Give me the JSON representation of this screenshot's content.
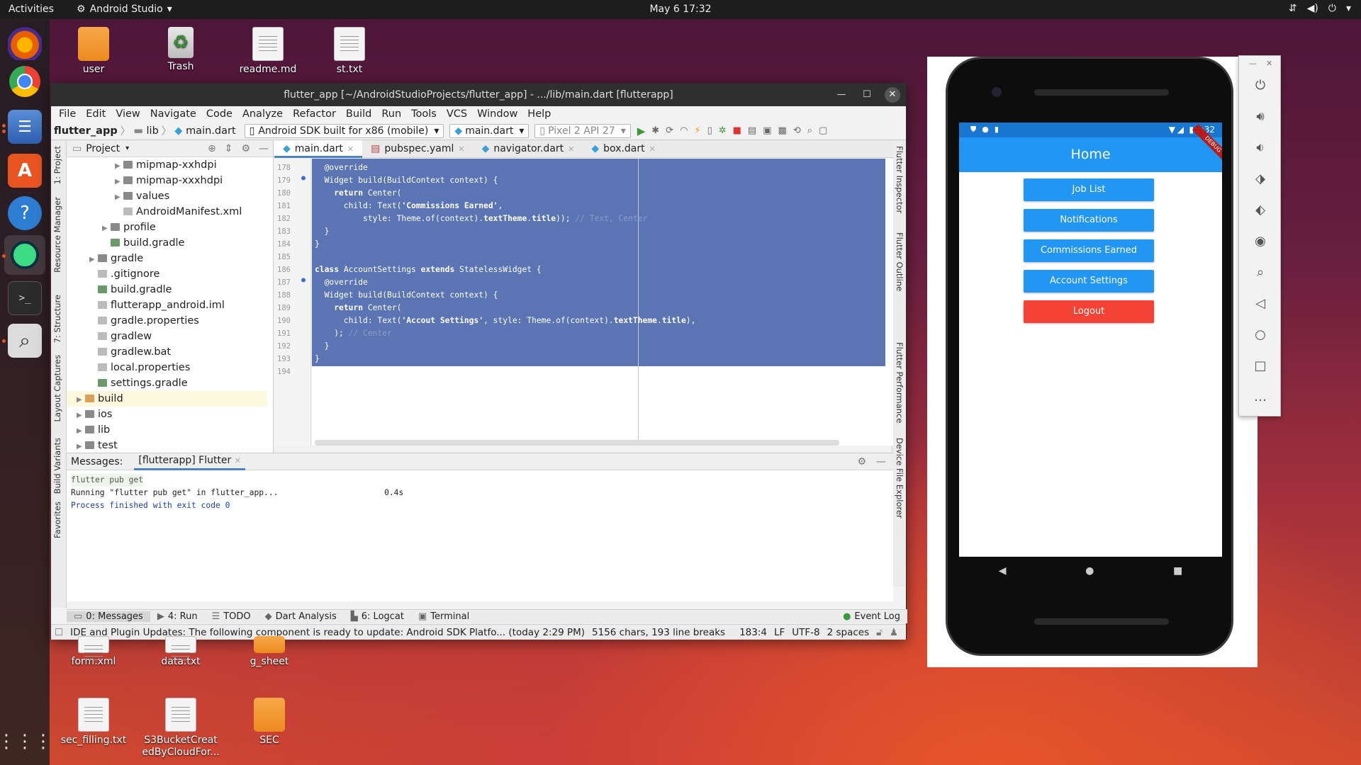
{
  "topbar": {
    "activities": "Activities",
    "app": "Android Studio",
    "clock": "May 6  17:32"
  },
  "desktop": {
    "top_icons": [
      {
        "label": "user",
        "kind": "folder"
      },
      {
        "label": "Trash",
        "kind": "trash"
      },
      {
        "label": "readme.md",
        "kind": "doc"
      },
      {
        "label": "st.txt",
        "kind": "doc"
      }
    ],
    "bottom_row1": [
      {
        "label": "form.xml",
        "kind": "doc"
      },
      {
        "label": "data.txt",
        "kind": "doc"
      },
      {
        "label": "g_sheet",
        "kind": "folder"
      }
    ],
    "bottom_row2": [
      {
        "label": "sec_filling.txt",
        "kind": "doc"
      },
      {
        "label": "S3BucketCreatedByCloudFor...",
        "kind": "doc"
      },
      {
        "label": "SEC",
        "kind": "folder"
      }
    ]
  },
  "ide": {
    "title": "flutter_app [~/AndroidStudioProjects/flutter_app] - .../lib/main.dart [flutterapp]",
    "menu": [
      "File",
      "Edit",
      "View",
      "Navigate",
      "Code",
      "Analyze",
      "Refactor",
      "Build",
      "Run",
      "Tools",
      "VCS",
      "Window",
      "Help"
    ],
    "breadcrumb": [
      "flutter_app",
      "lib",
      "main.dart"
    ],
    "device_combo": "Android SDK built for x86 (mobile)",
    "config_combo": "main.dart",
    "avd_combo": "Pixel 2 API 27",
    "project_label": "Project",
    "tree": [
      {
        "indent": 4,
        "arrow": "▶",
        "icon": "fold",
        "label": "mipmap-xxhdpi"
      },
      {
        "indent": 4,
        "arrow": "▶",
        "icon": "fold",
        "label": "mipmap-xxxhdpi"
      },
      {
        "indent": 4,
        "arrow": "▶",
        "icon": "fold",
        "label": "values"
      },
      {
        "indent": 4,
        "arrow": "",
        "icon": "file",
        "label": "AndroidManifest.xml"
      },
      {
        "indent": 3,
        "arrow": "▶",
        "icon": "fold",
        "label": "profile"
      },
      {
        "indent": 3,
        "arrow": "",
        "icon": "gradle",
        "label": "build.gradle"
      },
      {
        "indent": 2,
        "arrow": "▶",
        "icon": "fold",
        "label": "gradle"
      },
      {
        "indent": 2,
        "arrow": "",
        "icon": "file",
        "label": ".gitignore"
      },
      {
        "indent": 2,
        "arrow": "",
        "icon": "gradle",
        "label": "build.gradle"
      },
      {
        "indent": 2,
        "arrow": "",
        "icon": "file",
        "label": "flutterapp_android.iml"
      },
      {
        "indent": 2,
        "arrow": "",
        "icon": "file",
        "label": "gradle.properties"
      },
      {
        "indent": 2,
        "arrow": "",
        "icon": "file",
        "label": "gradlew"
      },
      {
        "indent": 2,
        "arrow": "",
        "icon": "file",
        "label": "gradlew.bat"
      },
      {
        "indent": 2,
        "arrow": "",
        "icon": "file",
        "label": "local.properties"
      },
      {
        "indent": 2,
        "arrow": "",
        "icon": "gradle",
        "label": "settings.gradle"
      },
      {
        "indent": 1,
        "arrow": "▶",
        "icon": "foldy",
        "label": "build",
        "hl": true
      },
      {
        "indent": 1,
        "arrow": "▶",
        "icon": "fold",
        "label": "ios"
      },
      {
        "indent": 1,
        "arrow": "▶",
        "icon": "fold",
        "label": "lib"
      },
      {
        "indent": 1,
        "arrow": "▶",
        "icon": "fold",
        "label": "test"
      }
    ],
    "tabs": [
      "main.dart",
      "pubspec.yaml",
      "navigator.dart",
      "box.dart"
    ],
    "line_numbers": [
      "178",
      "179",
      "180",
      "181",
      "182",
      "183",
      "184",
      "185",
      "186",
      "187",
      "188",
      "189",
      "190",
      "191",
      "192",
      "193",
      "194"
    ],
    "code_lines": [
      [
        {
          "t": "  @override"
        }
      ],
      [
        {
          "t": "  Widget build(BuildContext context) {"
        }
      ],
      [
        {
          "t": "    "
        },
        {
          "t": "return",
          "b": 1
        },
        {
          "t": " Center("
        }
      ],
      [
        {
          "t": "      child: Text("
        },
        {
          "t": "'Commissions Earned'",
          "b": 1
        },
        {
          "t": ","
        }
      ],
      [
        {
          "t": "          style: Theme."
        },
        {
          "t": "of"
        },
        {
          "t": "(context)."
        },
        {
          "t": "textTheme",
          "b": 1
        },
        {
          "t": "."
        },
        {
          "t": "title",
          "b": 1
        },
        {
          "t": ")); "
        },
        {
          "t": "// Text, Center",
          "c": 1
        }
      ],
      [
        {
          "t": "  }"
        }
      ],
      [
        {
          "t": "}"
        }
      ],
      [
        {
          "t": ""
        }
      ],
      [
        {
          "t": "class",
          "b": 1
        },
        {
          "t": " AccountSettings "
        },
        {
          "t": "extends",
          "b": 1
        },
        {
          "t": " StatelessWidget {"
        }
      ],
      [
        {
          "t": "  @override"
        }
      ],
      [
        {
          "t": "  Widget build(BuildContext context) {"
        }
      ],
      [
        {
          "t": "    "
        },
        {
          "t": "return",
          "b": 1
        },
        {
          "t": " Center("
        }
      ],
      [
        {
          "t": "      child: Text("
        },
        {
          "t": "'Accout Settings'",
          "b": 1
        },
        {
          "t": ", style: Theme."
        },
        {
          "t": "of"
        },
        {
          "t": "(context)."
        },
        {
          "t": "textTheme",
          "b": 1
        },
        {
          "t": "."
        },
        {
          "t": "title",
          "b": 1
        },
        {
          "t": "),"
        }
      ],
      [
        {
          "t": "    ); "
        },
        {
          "t": "// Center",
          "c": 1
        }
      ],
      [
        {
          "t": "  }"
        }
      ],
      [
        {
          "t": "}"
        }
      ],
      [
        {
          "t": ""
        }
      ]
    ],
    "messages_label": "Messages:",
    "messages_tab": "[flutterapp] Flutter",
    "messages": [
      {
        "text": "flutter pub get",
        "color": "#555",
        "bg": "#eef5ea"
      },
      {
        "text": "Running \"flutter pub get\" in flutter_app...                      0.4s",
        "color": "#222",
        "bg": ""
      },
      {
        "text": "Process finished with exit code 0",
        "color": "#1a3ea8",
        "bg": ""
      }
    ],
    "tool_windows": [
      "0: Messages",
      "4: Run",
      "TODO",
      "Dart Analysis",
      "6: Logcat",
      "Terminal"
    ],
    "event_log": "Event Log",
    "status": {
      "message": "IDE and Plugin Updates: The following component is ready to update: Android SDK Platfo... (today 2:29 PM)",
      "chars": "5156 chars, 193 line breaks",
      "pos": "183:4",
      "sep": "LF",
      "enc": "UTF-8",
      "indent": "2 spaces"
    },
    "left_tabs": [
      "1: Project",
      "Resource Manager",
      "7: Structure",
      "Layout Captures",
      "Build Variants",
      "Favorites"
    ],
    "right_tabs": [
      "Flutter Inspector",
      "Flutter Outline",
      "Flutter Performance",
      "Device File Explorer"
    ]
  },
  "phone": {
    "status_time": "5:32",
    "app_title": "Home",
    "debug_ribbon": "DEBUG",
    "buttons": [
      {
        "label": "Job List",
        "color": "#2196f3"
      },
      {
        "label": "Notifications",
        "color": "#2196f3"
      },
      {
        "label": "Commissions Earned",
        "color": "#2196f3"
      },
      {
        "label": "Account Settings",
        "color": "#2196f3"
      },
      {
        "label": "Logout",
        "color": "#f44336"
      }
    ]
  },
  "emulator_controls": [
    "power-icon",
    "volume-up-icon",
    "volume-down-icon",
    "rotate-left-icon",
    "rotate-right-icon",
    "camera-icon",
    "zoom-icon",
    "back-icon",
    "home-icon",
    "overview-icon",
    "more-icon"
  ],
  "colors": {
    "accent": "#e95420",
    "selection": "#5b74b3",
    "appbar": "#2196f3",
    "logout": "#f44336"
  }
}
